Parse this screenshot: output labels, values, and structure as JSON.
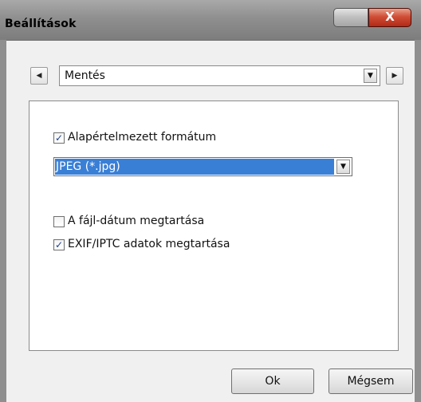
{
  "window": {
    "title": "Beállítások",
    "close_symbol": "X"
  },
  "section_nav": {
    "prev_symbol": "◀",
    "next_symbol": "▶",
    "selected": "Mentés",
    "dropdown_symbol": "▼"
  },
  "options": {
    "default_format": {
      "label": "Alapértelmezett formátum",
      "checked": true
    },
    "format_select": {
      "value": "JPEG (*.jpg)",
      "dropdown_symbol": "▼"
    },
    "keep_file_date": {
      "label": "A fájl-dátum megtartása",
      "checked": false
    },
    "keep_exif_iptc": {
      "label": "EXIF/IPTC adatok megtartása",
      "checked": true
    }
  },
  "check_mark": "✓",
  "buttons": {
    "ok": "Ok",
    "cancel": "Mégsem"
  },
  "colors": {
    "selection_blue": "#3a7fd6",
    "close_red": "#c43a22",
    "frame_gray": "#8f8f8f"
  }
}
